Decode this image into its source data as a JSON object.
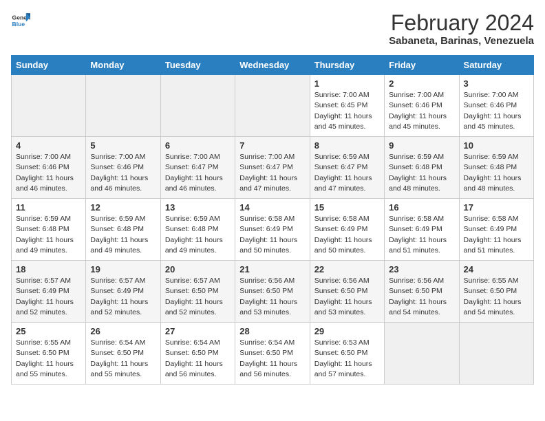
{
  "logo": {
    "text_general": "General",
    "text_blue": "Blue"
  },
  "title": {
    "month_year": "February 2024",
    "location": "Sabaneta, Barinas, Venezuela"
  },
  "headers": [
    "Sunday",
    "Monday",
    "Tuesday",
    "Wednesday",
    "Thursday",
    "Friday",
    "Saturday"
  ],
  "weeks": [
    [
      {
        "day": "",
        "info": "",
        "empty": true
      },
      {
        "day": "",
        "info": "",
        "empty": true
      },
      {
        "day": "",
        "info": "",
        "empty": true
      },
      {
        "day": "",
        "info": "",
        "empty": true
      },
      {
        "day": "1",
        "info": "Sunrise: 7:00 AM\nSunset: 6:45 PM\nDaylight: 11 hours\nand 45 minutes.",
        "empty": false
      },
      {
        "day": "2",
        "info": "Sunrise: 7:00 AM\nSunset: 6:46 PM\nDaylight: 11 hours\nand 45 minutes.",
        "empty": false
      },
      {
        "day": "3",
        "info": "Sunrise: 7:00 AM\nSunset: 6:46 PM\nDaylight: 11 hours\nand 45 minutes.",
        "empty": false
      }
    ],
    [
      {
        "day": "4",
        "info": "Sunrise: 7:00 AM\nSunset: 6:46 PM\nDaylight: 11 hours\nand 46 minutes.",
        "empty": false
      },
      {
        "day": "5",
        "info": "Sunrise: 7:00 AM\nSunset: 6:46 PM\nDaylight: 11 hours\nand 46 minutes.",
        "empty": false
      },
      {
        "day": "6",
        "info": "Sunrise: 7:00 AM\nSunset: 6:47 PM\nDaylight: 11 hours\nand 46 minutes.",
        "empty": false
      },
      {
        "day": "7",
        "info": "Sunrise: 7:00 AM\nSunset: 6:47 PM\nDaylight: 11 hours\nand 47 minutes.",
        "empty": false
      },
      {
        "day": "8",
        "info": "Sunrise: 6:59 AM\nSunset: 6:47 PM\nDaylight: 11 hours\nand 47 minutes.",
        "empty": false
      },
      {
        "day": "9",
        "info": "Sunrise: 6:59 AM\nSunset: 6:48 PM\nDaylight: 11 hours\nand 48 minutes.",
        "empty": false
      },
      {
        "day": "10",
        "info": "Sunrise: 6:59 AM\nSunset: 6:48 PM\nDaylight: 11 hours\nand 48 minutes.",
        "empty": false
      }
    ],
    [
      {
        "day": "11",
        "info": "Sunrise: 6:59 AM\nSunset: 6:48 PM\nDaylight: 11 hours\nand 49 minutes.",
        "empty": false
      },
      {
        "day": "12",
        "info": "Sunrise: 6:59 AM\nSunset: 6:48 PM\nDaylight: 11 hours\nand 49 minutes.",
        "empty": false
      },
      {
        "day": "13",
        "info": "Sunrise: 6:59 AM\nSunset: 6:48 PM\nDaylight: 11 hours\nand 49 minutes.",
        "empty": false
      },
      {
        "day": "14",
        "info": "Sunrise: 6:58 AM\nSunset: 6:49 PM\nDaylight: 11 hours\nand 50 minutes.",
        "empty": false
      },
      {
        "day": "15",
        "info": "Sunrise: 6:58 AM\nSunset: 6:49 PM\nDaylight: 11 hours\nand 50 minutes.",
        "empty": false
      },
      {
        "day": "16",
        "info": "Sunrise: 6:58 AM\nSunset: 6:49 PM\nDaylight: 11 hours\nand 51 minutes.",
        "empty": false
      },
      {
        "day": "17",
        "info": "Sunrise: 6:58 AM\nSunset: 6:49 PM\nDaylight: 11 hours\nand 51 minutes.",
        "empty": false
      }
    ],
    [
      {
        "day": "18",
        "info": "Sunrise: 6:57 AM\nSunset: 6:49 PM\nDaylight: 11 hours\nand 52 minutes.",
        "empty": false
      },
      {
        "day": "19",
        "info": "Sunrise: 6:57 AM\nSunset: 6:49 PM\nDaylight: 11 hours\nand 52 minutes.",
        "empty": false
      },
      {
        "day": "20",
        "info": "Sunrise: 6:57 AM\nSunset: 6:50 PM\nDaylight: 11 hours\nand 52 minutes.",
        "empty": false
      },
      {
        "day": "21",
        "info": "Sunrise: 6:56 AM\nSunset: 6:50 PM\nDaylight: 11 hours\nand 53 minutes.",
        "empty": false
      },
      {
        "day": "22",
        "info": "Sunrise: 6:56 AM\nSunset: 6:50 PM\nDaylight: 11 hours\nand 53 minutes.",
        "empty": false
      },
      {
        "day": "23",
        "info": "Sunrise: 6:56 AM\nSunset: 6:50 PM\nDaylight: 11 hours\nand 54 minutes.",
        "empty": false
      },
      {
        "day": "24",
        "info": "Sunrise: 6:55 AM\nSunset: 6:50 PM\nDaylight: 11 hours\nand 54 minutes.",
        "empty": false
      }
    ],
    [
      {
        "day": "25",
        "info": "Sunrise: 6:55 AM\nSunset: 6:50 PM\nDaylight: 11 hours\nand 55 minutes.",
        "empty": false
      },
      {
        "day": "26",
        "info": "Sunrise: 6:54 AM\nSunset: 6:50 PM\nDaylight: 11 hours\nand 55 minutes.",
        "empty": false
      },
      {
        "day": "27",
        "info": "Sunrise: 6:54 AM\nSunset: 6:50 PM\nDaylight: 11 hours\nand 56 minutes.",
        "empty": false
      },
      {
        "day": "28",
        "info": "Sunrise: 6:54 AM\nSunset: 6:50 PM\nDaylight: 11 hours\nand 56 minutes.",
        "empty": false
      },
      {
        "day": "29",
        "info": "Sunrise: 6:53 AM\nSunset: 6:50 PM\nDaylight: 11 hours\nand 57 minutes.",
        "empty": false
      },
      {
        "day": "",
        "info": "",
        "empty": true
      },
      {
        "day": "",
        "info": "",
        "empty": true
      }
    ]
  ]
}
